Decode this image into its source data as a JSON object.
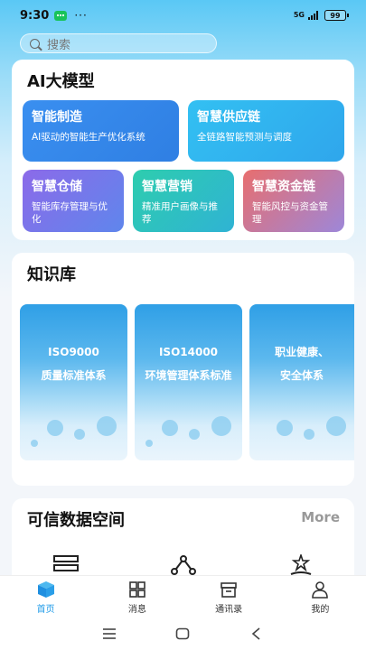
{
  "status_bar": {
    "time": "9:30",
    "dots": "···",
    "network": "5G",
    "battery": "99"
  },
  "search": {
    "placeholder": "搜索"
  },
  "ai_section": {
    "title": "AI大模型",
    "tiles": [
      {
        "title": "智能制造",
        "desc": "AI驱动的智能生产优化系统",
        "color": "#2a8de6"
      },
      {
        "title": "智慧供应链",
        "desc": "全链路智能预测与调度",
        "color": "#2fb6ee"
      },
      {
        "title": "智慧仓储",
        "desc": "智能库存管理与优化",
        "color": "#7a6de8"
      },
      {
        "title": "智慧营销",
        "desc": "精准用户画像与推荐",
        "color": "#2fc7b8"
      },
      {
        "title": "智慧资金链",
        "desc": "智能风控与资金管理",
        "color": "#e07575"
      }
    ]
  },
  "knowledge": {
    "title": "知识库",
    "items": [
      {
        "line1": "ISO9000",
        "line2": "质量标准体系"
      },
      {
        "line1": "ISO14000",
        "line2": "环境管理体系标准"
      },
      {
        "line1": "职业健康、",
        "line2": "安全体系"
      }
    ]
  },
  "trust": {
    "title": "可信数据空间",
    "more": "More"
  },
  "nav": {
    "items": [
      {
        "label": "首页",
        "icon": "cube-icon",
        "active": true
      },
      {
        "label": "消息",
        "icon": "grid-icon"
      },
      {
        "label": "通讯录",
        "icon": "box-icon"
      },
      {
        "label": "我的",
        "icon": "user-icon"
      }
    ]
  },
  "colors": {
    "accent": "#1f9be8"
  }
}
